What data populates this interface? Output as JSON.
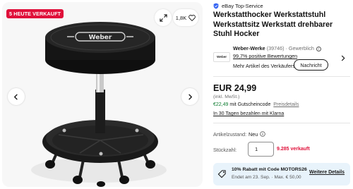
{
  "gallery": {
    "badge": "5 HEUTE VERKAUFT",
    "watch_count": "1,8K",
    "logo_text": "Weber"
  },
  "listing": {
    "top_service": "eBay Top-Service",
    "title": "Werkstatthocker Werkstattstuhl Werkstattsitz Werkstatt drehbarer Stuhl Hocker"
  },
  "seller": {
    "logo_text": "Weber",
    "name": "Weber-Werke",
    "count": "(39746)",
    "type": "· Gewerblich",
    "rating": "99,7% positive Bewertungen",
    "more": "Mehr Artikel des Verkäufers",
    "contact": "Nachricht"
  },
  "pricing": {
    "price": "EUR 24,99",
    "tax": "(inkl. MwSt.)",
    "coupon_price": "€22,49",
    "coupon_text": " mit Gutscheincode",
    "coupon_link": "Preisdetails",
    "klarna": "In 30 Tagen bezahlen mit Klarna"
  },
  "condition": {
    "label": "Artikelzustand:",
    "value": "Neu"
  },
  "quantity": {
    "label": "Stückzahl:",
    "value": "1",
    "sold": "9.285 verkauft"
  },
  "promo": {
    "title": "10% Rabatt mit Code MOTORS26",
    "subtitle": "Endet am 23. Sep. · Max. € 50,00",
    "link": "Weitere Details"
  },
  "colors": {
    "badge": "#e0103a",
    "coupon": "#0a7a2e",
    "promo_bg": "#e8f3fb"
  }
}
